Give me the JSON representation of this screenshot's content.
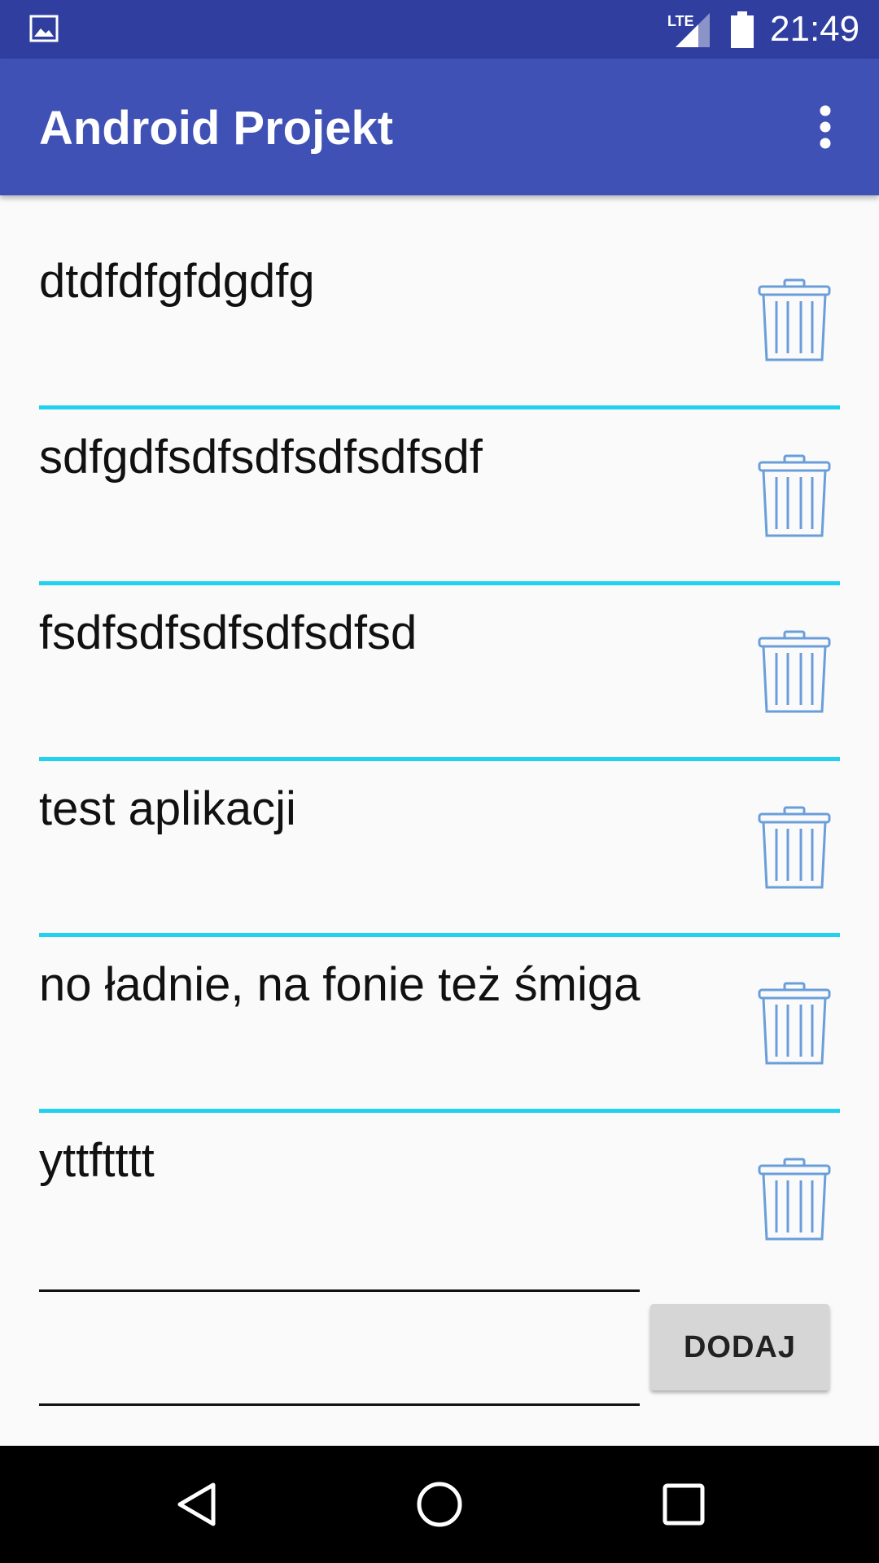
{
  "status_bar": {
    "network": "LTE",
    "time": "21:49",
    "icons": [
      "gallery-icon",
      "lte-signal-icon",
      "battery-icon"
    ]
  },
  "app_bar": {
    "title": "Android Projekt",
    "menu_icon": "more-vert-icon"
  },
  "items": [
    {
      "text": "dtdfdfgfdgdfg"
    },
    {
      "text": "sdfgdfsdfsdfsdfsdfsdf"
    },
    {
      "text": "fsdfsdfsdfsdfsdfsd"
    },
    {
      "text": "test aplikacji"
    },
    {
      "text": "no ładnie, na fonie też śmiga"
    },
    {
      "text": "yttftttt"
    }
  ],
  "input": {
    "value": "",
    "placeholder": ""
  },
  "add_button": {
    "label": "DODAJ"
  },
  "nav_bar": {
    "icons": [
      "back-icon",
      "home-icon",
      "recents-icon"
    ]
  },
  "colors": {
    "status_bar": "#303f9f",
    "app_bar": "#3f51b5",
    "divider": "#22d1ee",
    "trash_icon": "#6a9edb"
  }
}
